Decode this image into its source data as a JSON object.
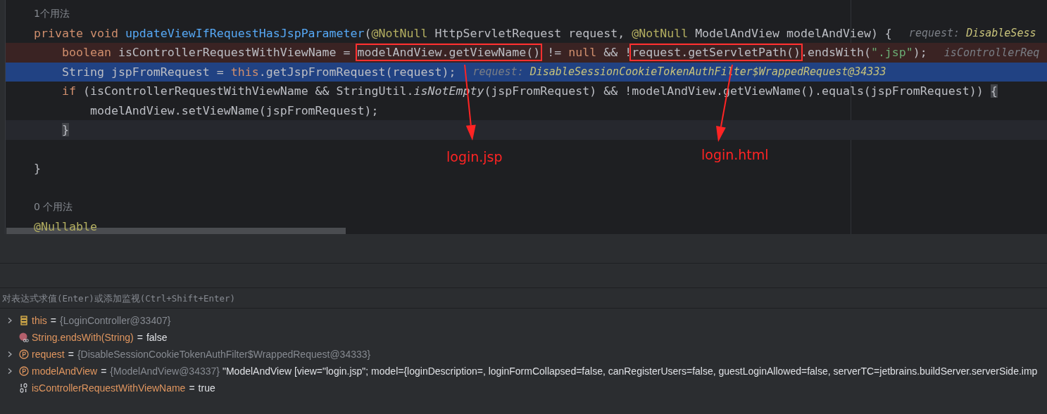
{
  "editor": {
    "lines": [
      {
        "kind": "usage",
        "text": "1个用法"
      },
      {
        "kind": "code",
        "tokens": [
          {
            "kind": "keyword",
            "text": "private void "
          },
          {
            "kind": "method",
            "text": "updateViewIfRequestHasJspParameter"
          },
          {
            "kind": "plain",
            "text": "("
          },
          {
            "kind": "annotation",
            "text": "@NotNull"
          },
          {
            "kind": "plain",
            "text": " HttpServletRequest request, "
          },
          {
            "kind": "annotation",
            "text": "@NotNull"
          },
          {
            "kind": "plain",
            "text": " ModelAndView modelAndView) {"
          },
          {
            "kind": "hint-name",
            "text": "request: "
          },
          {
            "kind": "hint-value",
            "text": "DisableSess"
          }
        ]
      },
      {
        "kind": "breakpoint",
        "tokens": [
          {
            "kind": "keyword",
            "text": "    boolean "
          },
          {
            "kind": "plain",
            "text": "isControllerRequestWithViewName = "
          },
          {
            "kind": "plain",
            "text": "modelAndView.getViewName()",
            "boxed": true
          },
          {
            "kind": "plain",
            "text": " != "
          },
          {
            "kind": "keyword",
            "text": "null"
          },
          {
            "kind": "plain",
            "text": " && !"
          },
          {
            "kind": "plain",
            "text": "request.getServletPath()",
            "boxed": true
          },
          {
            "kind": "plain",
            "text": ".endsWith("
          },
          {
            "kind": "string",
            "text": "\".jsp\""
          },
          {
            "kind": "plain",
            "text": ");"
          },
          {
            "kind": "hint-name",
            "text": "isControllerReq"
          }
        ]
      },
      {
        "kind": "execution-point",
        "tokens": [
          {
            "kind": "plain",
            "text": "    String jspFromRequest = "
          },
          {
            "kind": "keyword",
            "text": "this"
          },
          {
            "kind": "plain",
            "text": ".getJspFromRequest(request);"
          },
          {
            "kind": "hint-name",
            "text": "request: "
          },
          {
            "kind": "hint-value",
            "text": "DisableSessionCookieTokenAuthFilter$WrappedRequest@34333"
          }
        ]
      },
      {
        "kind": "code",
        "tokens": [
          {
            "kind": "keyword",
            "text": "    if "
          },
          {
            "kind": "plain",
            "text": "(isControllerRequestWithViewName && StringUtil."
          },
          {
            "kind": "static",
            "text": "isNotEmpty"
          },
          {
            "kind": "plain",
            "text": "(jspFromRequest) && !modelAndView.getViewName().equals(jspFromRequest)) "
          },
          {
            "kind": "brace",
            "text": "{"
          }
        ]
      },
      {
        "kind": "code",
        "tokens": [
          {
            "kind": "plain",
            "text": "        modelAndView.setViewName(jspFromRequest);"
          }
        ]
      },
      {
        "kind": "caret",
        "tokens": [
          {
            "kind": "brace",
            "text": "    }"
          }
        ]
      },
      {
        "kind": "blank"
      },
      {
        "kind": "code",
        "tokens": [
          {
            "kind": "plain",
            "text": "}"
          }
        ]
      },
      {
        "kind": "blank"
      },
      {
        "kind": "usage",
        "text": "0 个用法"
      },
      {
        "kind": "code",
        "tokens": [
          {
            "kind": "annotation",
            "text": "@Nullable"
          }
        ]
      }
    ],
    "annotations": [
      {
        "text": "login.jsp"
      },
      {
        "text": "login.html"
      }
    ]
  },
  "evaluate": {
    "placeholder": "对表达式求值(Enter)或添加监视(Ctrl+Shift+Enter)"
  },
  "variables": [
    {
      "name": "this",
      "operator": "=",
      "kind": "fields",
      "expandable": true,
      "ref": "{LoginController@33407}"
    },
    {
      "name": "String.endsWith(String)",
      "operator": "=",
      "kind": "method",
      "expandable": false,
      "value": "false"
    },
    {
      "name": "request",
      "operator": "=",
      "kind": "parameter",
      "expandable": true,
      "ref": "{DisableSessionCookieTokenAuthFilter$WrappedRequest@34333}"
    },
    {
      "name": "modelAndView",
      "operator": "=",
      "kind": "parameter",
      "expandable": true,
      "ref": "{ModelAndView@34337}",
      "value": "\"ModelAndView [view=\"login.jsp\"; model={loginDescription=, loginFormCollapsed=false, canRegisterUsers=false, guestLoginAllowed=false, serverTC=jetbrains.buildServer.serverSide.imp"
    },
    {
      "name": "isControllerRequestWithViewName",
      "operator": "=",
      "kind": "primitive",
      "expandable": false,
      "value": "true"
    }
  ]
}
